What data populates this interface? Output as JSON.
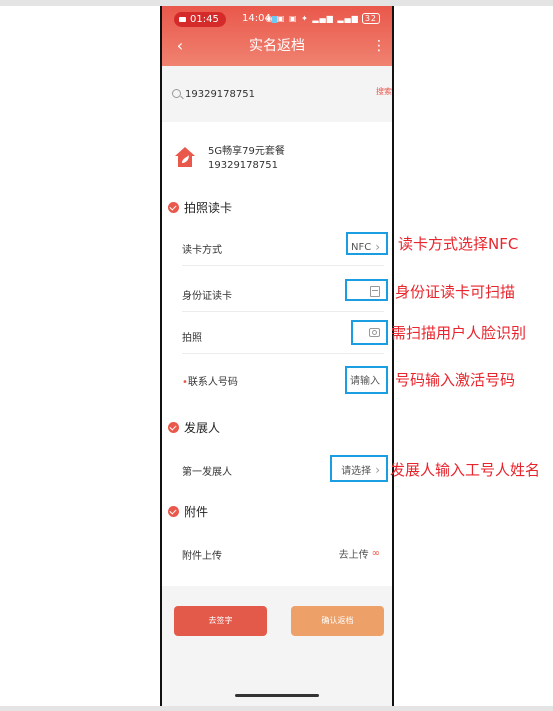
{
  "status_bar": {
    "call_time": "01:45",
    "clock": "14:04",
    "battery": "32"
  },
  "header": {
    "title": "实名返档"
  },
  "search": {
    "value": "19329178751",
    "button_label": "搜索"
  },
  "package": {
    "name": "5G畅享79元套餐",
    "phone": "19329178751"
  },
  "sections": {
    "photo_read": {
      "title": "拍照读卡",
      "rows": {
        "read_method": {
          "label": "读卡方式",
          "value": "NFC"
        },
        "id_read": {
          "label": "身份证读卡"
        },
        "photo": {
          "label": "拍照"
        },
        "contact": {
          "required_mark": "•",
          "label": "联系人号码",
          "value": "请输入"
        }
      }
    },
    "developer": {
      "title": "发展人",
      "rows": {
        "first_dev": {
          "label": "第一发展人",
          "value": "请选择"
        }
      }
    },
    "attachment": {
      "title": "附件",
      "rows": {
        "upload": {
          "label": "附件上传",
          "value": "去上传"
        }
      }
    }
  },
  "buttons": {
    "sign": "去签字",
    "confirm": "确认返档"
  },
  "annotations": {
    "read_method": "读卡方式选择NFC",
    "id_read": "身份证读卡可扫描",
    "photo": "需扫描用户人脸识别",
    "contact": "号码输入激活号码",
    "developer": "发展人输入工号人姓名"
  },
  "colors": {
    "accent": "#e9584b",
    "highlight": "#1b9de2",
    "annotation": "#e8242c"
  }
}
